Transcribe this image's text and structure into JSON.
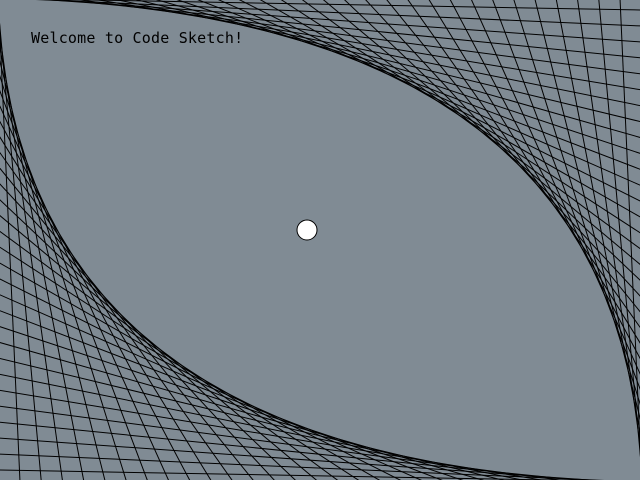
{
  "sketch": {
    "welcome_text": "Welcome to Code Sketch!",
    "background_color": "#808b94",
    "line_color": "#000000",
    "ball_color": "#ffffff",
    "ball_outline_color": "#000000"
  }
}
